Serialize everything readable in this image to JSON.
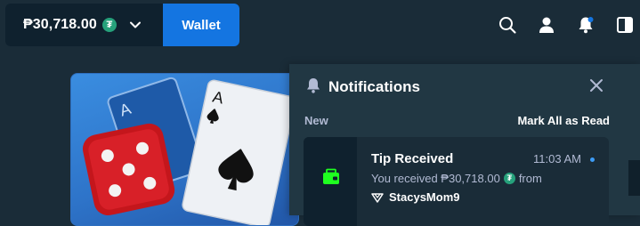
{
  "header": {
    "balance": "₱30,718.00",
    "currency_icon": "tether-icon",
    "wallet_label": "Wallet",
    "icons": [
      "search-icon",
      "user-icon",
      "notifications-icon",
      "sidebar-toggle-icon"
    ]
  },
  "notifications": {
    "title": "Notifications",
    "section_label": "New",
    "mark_all_label": "Mark All as Read",
    "items": [
      {
        "title": "Tip Received",
        "time": "11:03 AM",
        "message_prefix": "You received ₱30,718.00",
        "message_suffix": "from",
        "sender": "StacysMom9",
        "icon": "wallet-icon"
      }
    ]
  },
  "colors": {
    "background": "#1a2c38",
    "panel": "#213743",
    "wallet_button": "#1475e1",
    "tether": "#26a17b",
    "accent_green": "#1fff20"
  }
}
